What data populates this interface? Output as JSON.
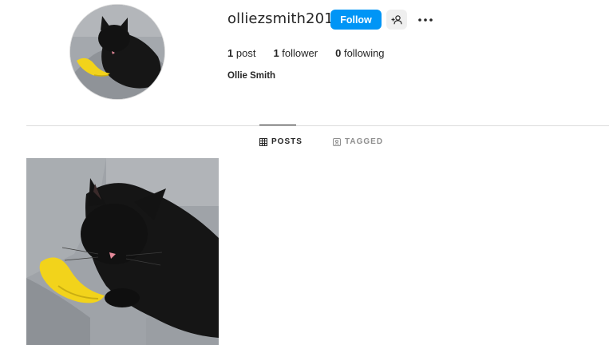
{
  "profile": {
    "username": "olliezsmith2010",
    "full_name": "Ollie Smith",
    "follow_label": "Follow",
    "stats": {
      "posts_count": "1",
      "posts_label": "post",
      "followers_count": "1",
      "followers_label": "follower",
      "following_count": "0",
      "following_label": "following"
    }
  },
  "tabs": {
    "posts_label": "POSTS",
    "tagged_label": "TAGGED",
    "active": "POSTS"
  },
  "icons": {
    "suggest": "add-person-icon",
    "more": "more-options-icon",
    "posts": "grid-icon",
    "tagged": "tagged-icon"
  },
  "colors": {
    "follow_button": "#0095f6",
    "secondary_button": "#efefef",
    "divider": "#dbdbdb",
    "inactive_tab": "#8e8e8e"
  }
}
